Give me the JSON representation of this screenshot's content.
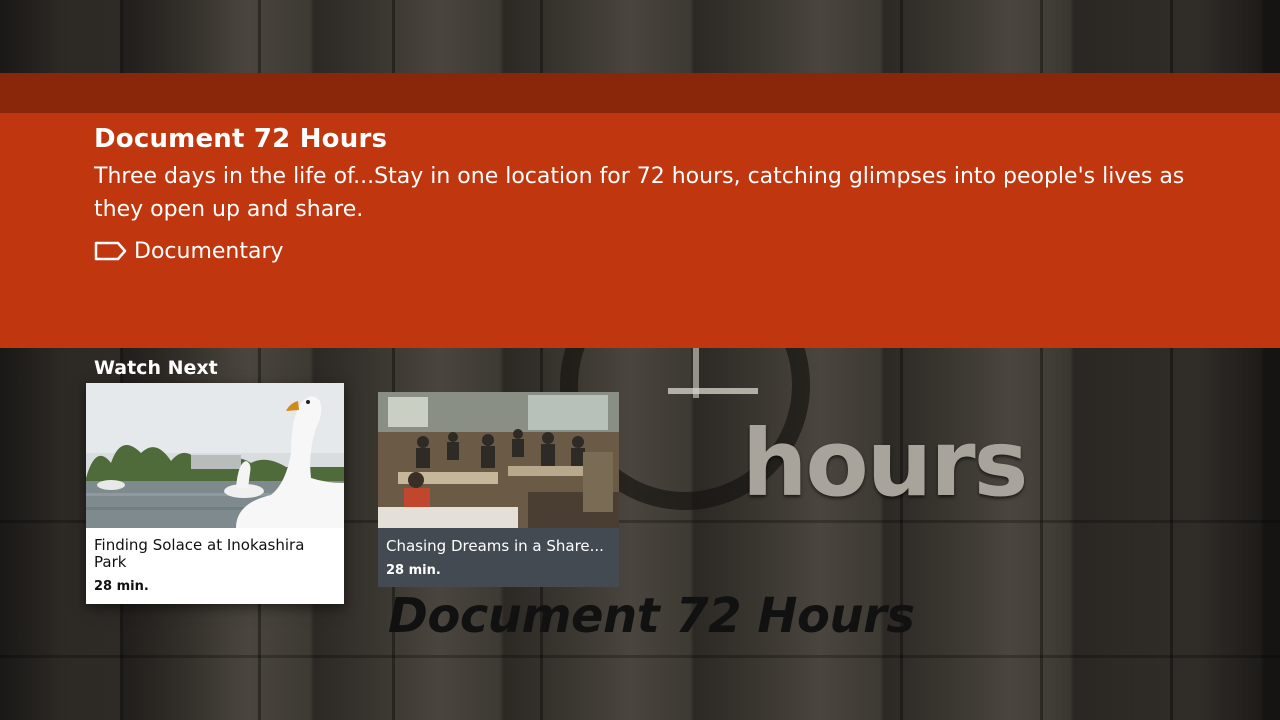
{
  "background": {
    "artwork_hours_text": "hours",
    "artwork_title_text": "Document 72 Hours"
  },
  "show": {
    "title": "Document 72 Hours",
    "description": "Three days in the life of...Stay in one location for 72 hours, catching glimpses into people's lives as they open up and share.",
    "genre": "Documentary",
    "genre_icon": "tag-icon"
  },
  "watch_next": {
    "heading": "Watch Next",
    "items": [
      {
        "title": "Finding Solace at Inokashira Park",
        "duration": "28 min.",
        "focused": true,
        "thumbnail": "swan-boats-on-pond"
      },
      {
        "title": "Chasing Dreams in a Share...",
        "duration": "28 min.",
        "focused": false,
        "thumbnail": "shared-workspace-cafe"
      }
    ]
  },
  "colors": {
    "banner_main": "#c0360f",
    "banner_dark": "#8a270b",
    "card_unfocused": "#434a52",
    "card_focused": "#ffffff"
  }
}
